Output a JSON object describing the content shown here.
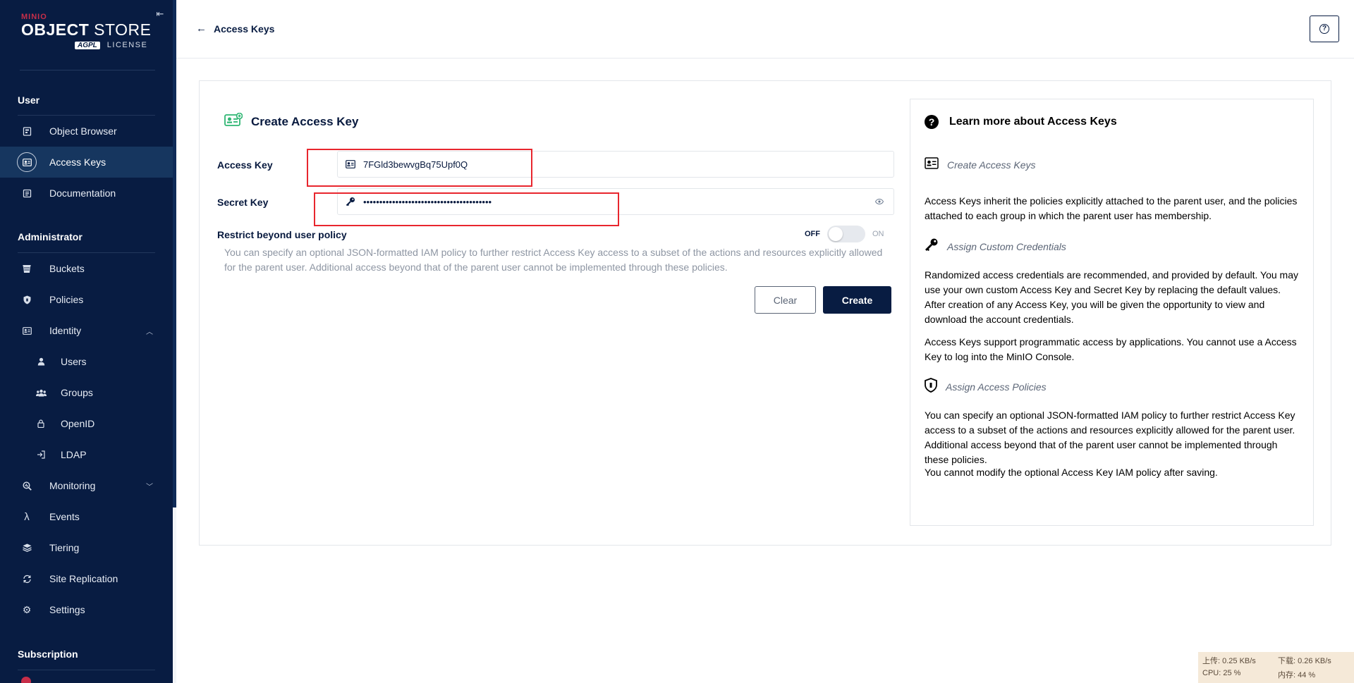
{
  "sidebar": {
    "logo": {
      "brand": "MINIO",
      "product_bold": "OBJECT",
      "product_light": " STORE",
      "edition": "AGPL",
      "license": "LICENSE"
    },
    "sections": [
      {
        "title": "User"
      },
      {
        "title": "Administrator"
      },
      {
        "title": "Subscription"
      }
    ],
    "items": [
      {
        "label": "Object Browser",
        "icon": "object-browser-icon",
        "active": false
      },
      {
        "label": "Access Keys",
        "icon": "access-keys-icon",
        "active": true
      },
      {
        "label": "Documentation",
        "icon": "documentation-icon",
        "active": false
      },
      {
        "label": "Buckets",
        "icon": "buckets-icon",
        "active": false
      },
      {
        "label": "Policies",
        "icon": "policies-icon",
        "active": false
      },
      {
        "label": "Identity",
        "icon": "identity-icon",
        "active": false,
        "expanded": true
      },
      {
        "label": "Users",
        "icon": "user-icon",
        "active": false
      },
      {
        "label": "Groups",
        "icon": "groups-icon",
        "active": false
      },
      {
        "label": "OpenID",
        "icon": "lock-icon",
        "active": false
      },
      {
        "label": "LDAP",
        "icon": "login-icon",
        "active": false
      },
      {
        "label": "Monitoring",
        "icon": "monitoring-icon",
        "active": false,
        "expanded": false
      },
      {
        "label": "Events",
        "icon": "lambda-icon",
        "active": false
      },
      {
        "label": "Tiering",
        "icon": "tiering-icon",
        "active": false
      },
      {
        "label": "Site Replication",
        "icon": "replication-icon",
        "active": false
      },
      {
        "label": "Settings",
        "icon": "gear-icon",
        "active": false
      }
    ]
  },
  "topbar": {
    "back_label": "Access Keys"
  },
  "form": {
    "title": "Create Access Key",
    "access_key_label": "Access Key",
    "access_key_value": "7FGld3bewvgBq75Upf0Q",
    "secret_key_label": "Secret Key",
    "secret_key_value": "••••••••••••••••••••••••••••••••••••••••",
    "restrict_label": "Restrict beyond user policy",
    "toggle_off": "OFF",
    "toggle_on": "ON",
    "toggle_state": false,
    "restrict_description": "You can specify an optional JSON-formatted IAM policy to further restrict Access Key access to a subset of the actions and resources explicitly allowed for the parent user. Additional access beyond that of the parent user cannot be implemented through these policies.",
    "clear_label": "Clear",
    "create_label": "Create"
  },
  "help": {
    "title": "Learn more about Access Keys",
    "sections": [
      {
        "subtitle": "Create Access Keys",
        "paragraphs": [
          "Access Keys inherit the policies explicitly attached to the parent user, and the policies attached to each group in which the parent user has membership."
        ]
      },
      {
        "subtitle": "Assign Custom Credentials",
        "paragraphs": [
          "Randomized access credentials are recommended, and provided by default. You may use your own custom Access Key and Secret Key by replacing the default values. After creation of any Access Key, you will be given the opportunity to view and download the account credentials.",
          "Access Keys support programmatic access by applications. You cannot use a Access Key to log into the MinIO Console."
        ]
      },
      {
        "subtitle": "Assign Access Policies",
        "paragraphs": [
          "You can specify an optional JSON-formatted IAM policy to further restrict Access Key access to a subset of the actions and resources explicitly allowed for the parent user. Additional access beyond that of the parent user cannot be implemented through these policies.",
          "You cannot modify the optional Access Key IAM policy after saving."
        ]
      }
    ]
  },
  "netmon": {
    "upload": "上传: 0.25 KB/s",
    "download": "下载: 0.26 KB/s",
    "cpu": "CPU: 25 %",
    "memory": "内存: 44 %"
  },
  "colors": {
    "sidebar_bg": "#081c42",
    "active_item_bg": "#16365f",
    "primary_button": "#081c42",
    "highlight_box": "#e8262e",
    "brand_red": "#c72e49",
    "title_icon_green": "#2fb673"
  }
}
